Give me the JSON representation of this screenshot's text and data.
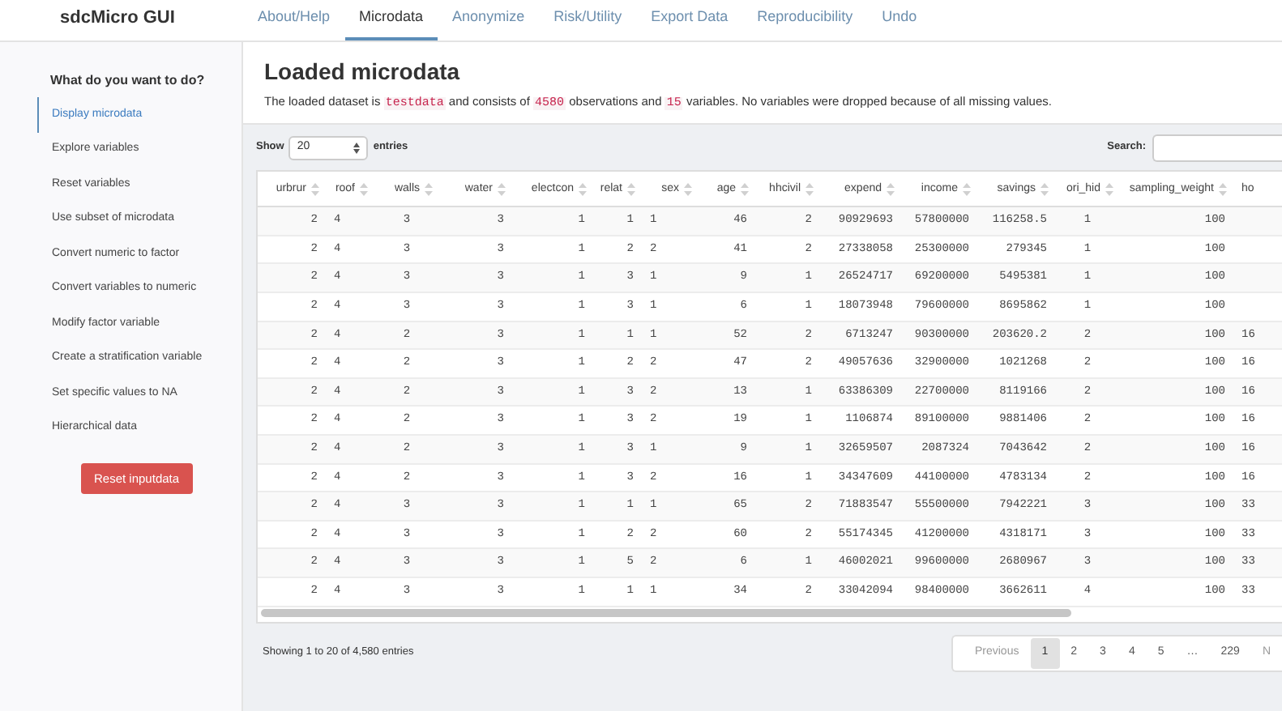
{
  "app_title": "sdcMicro GUI",
  "tabs": [
    {
      "label": "About/Help",
      "selected": false
    },
    {
      "label": "Microdata",
      "selected": true
    },
    {
      "label": "Anonymize",
      "selected": false
    },
    {
      "label": "Risk/Utility",
      "selected": false
    },
    {
      "label": "Export Data",
      "selected": false
    },
    {
      "label": "Reproducibility",
      "selected": false
    },
    {
      "label": "Undo",
      "selected": false
    }
  ],
  "sidebar": {
    "heading": "What do you want to do?",
    "items": [
      {
        "label": "Display microdata",
        "selected": true
      },
      {
        "label": "Explore variables",
        "selected": false
      },
      {
        "label": "Reset variables",
        "selected": false
      },
      {
        "label": "Use subset of microdata",
        "selected": false
      },
      {
        "label": "Convert numeric to factor",
        "selected": false
      },
      {
        "label": "Convert variables to numeric",
        "selected": false
      },
      {
        "label": "Modify factor variable",
        "selected": false
      },
      {
        "label": "Create a stratification variable",
        "selected": false
      },
      {
        "label": "Set specific values to NA",
        "selected": false
      },
      {
        "label": "Hierarchical data",
        "selected": false
      }
    ],
    "reset_button": "Reset inputdata"
  },
  "main": {
    "title": "Loaded microdata",
    "description": [
      {
        "kind": "text",
        "text": "The loaded dataset is "
      },
      {
        "kind": "code",
        "text": "testdata"
      },
      {
        "kind": "text",
        "text": " and consists of "
      },
      {
        "kind": "code",
        "text": "4580"
      },
      {
        "kind": "text",
        "text": " observations and "
      },
      {
        "kind": "code",
        "text": "15"
      },
      {
        "kind": "text",
        "text": " variables. No variables were dropped because of all missing values."
      }
    ],
    "show_label": "Show",
    "page_size": "20",
    "entries_label": "entries",
    "search_label": "Search:",
    "table": {
      "columns": [
        "urbrur",
        "roof",
        "walls",
        "water",
        "electcon",
        "relat",
        "sex",
        "age",
        "hhcivil",
        "expend",
        "income",
        "savings",
        "ori_hid",
        "sampling_weight",
        "ho"
      ],
      "rows": [
        [
          "2",
          "4",
          "3",
          "3",
          "1",
          "1",
          "1",
          "46",
          "2",
          "90929693",
          "57800000",
          "116258.5",
          "1",
          "100",
          ""
        ],
        [
          "2",
          "4",
          "3",
          "3",
          "1",
          "2",
          "2",
          "41",
          "2",
          "27338058",
          "25300000",
          "279345",
          "1",
          "100",
          ""
        ],
        [
          "2",
          "4",
          "3",
          "3",
          "1",
          "3",
          "1",
          "9",
          "1",
          "26524717",
          "69200000",
          "5495381",
          "1",
          "100",
          ""
        ],
        [
          "2",
          "4",
          "3",
          "3",
          "1",
          "3",
          "1",
          "6",
          "1",
          "18073948",
          "79600000",
          "8695862",
          "1",
          "100",
          ""
        ],
        [
          "2",
          "4",
          "2",
          "3",
          "1",
          "1",
          "1",
          "52",
          "2",
          "6713247",
          "90300000",
          "203620.2",
          "2",
          "100",
          "16"
        ],
        [
          "2",
          "4",
          "2",
          "3",
          "1",
          "2",
          "2",
          "47",
          "2",
          "49057636",
          "32900000",
          "1021268",
          "2",
          "100",
          "16"
        ],
        [
          "2",
          "4",
          "2",
          "3",
          "1",
          "3",
          "2",
          "13",
          "1",
          "63386309",
          "22700000",
          "8119166",
          "2",
          "100",
          "16"
        ],
        [
          "2",
          "4",
          "2",
          "3",
          "1",
          "3",
          "2",
          "19",
          "1",
          "1106874",
          "89100000",
          "9881406",
          "2",
          "100",
          "16"
        ],
        [
          "2",
          "4",
          "2",
          "3",
          "1",
          "3",
          "1",
          "9",
          "1",
          "32659507",
          "2087324",
          "7043642",
          "2",
          "100",
          "16"
        ],
        [
          "2",
          "4",
          "2",
          "3",
          "1",
          "3",
          "2",
          "16",
          "1",
          "34347609",
          "44100000",
          "4783134",
          "2",
          "100",
          "16"
        ],
        [
          "2",
          "4",
          "3",
          "3",
          "1",
          "1",
          "1",
          "65",
          "2",
          "71883547",
          "55500000",
          "7942221",
          "3",
          "100",
          "33"
        ],
        [
          "2",
          "4",
          "3",
          "3",
          "1",
          "2",
          "2",
          "60",
          "2",
          "55174345",
          "41200000",
          "4318171",
          "3",
          "100",
          "33"
        ],
        [
          "2",
          "4",
          "3",
          "3",
          "1",
          "5",
          "2",
          "6",
          "1",
          "46002021",
          "99600000",
          "2680967",
          "3",
          "100",
          "33"
        ],
        [
          "2",
          "4",
          "3",
          "3",
          "1",
          "1",
          "1",
          "34",
          "2",
          "33042094",
          "98400000",
          "3662611",
          "4",
          "100",
          "33"
        ]
      ]
    },
    "footer": "Showing 1 to 20 of 4,580 entries",
    "pagination": [
      {
        "label": "Previous",
        "kind": "nav",
        "selected": false
      },
      {
        "label": "1",
        "kind": "page",
        "selected": true
      },
      {
        "label": "2",
        "kind": "page",
        "selected": false
      },
      {
        "label": "3",
        "kind": "page",
        "selected": false
      },
      {
        "label": "4",
        "kind": "page",
        "selected": false
      },
      {
        "label": "5",
        "kind": "page",
        "selected": false
      },
      {
        "label": "…",
        "kind": "ellipsis",
        "selected": false
      },
      {
        "label": "229",
        "kind": "page",
        "selected": false
      },
      {
        "label": "N",
        "kind": "nav",
        "selected": false
      }
    ]
  }
}
